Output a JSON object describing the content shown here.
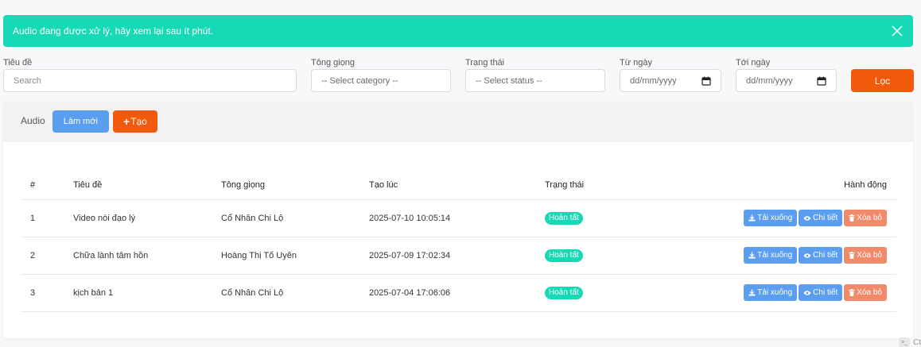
{
  "alert": {
    "message": "Audio đang được xử lý, hãy xem lại sau ít phút."
  },
  "filters": {
    "title_label": "Tiêu đề",
    "title_placeholder": "Search",
    "voice_label": "Tông giọng",
    "voice_value": "-- Select category --",
    "status_label": "Trạng thái",
    "status_value": "-- Select status --",
    "from_label": "Từ ngày",
    "from_value": "dd/mm/yyyy",
    "to_label": "Tới ngày",
    "to_value": "dd/mm/yyyy",
    "filter_button": "Lọc"
  },
  "card": {
    "title": "Audio",
    "refresh_button": "Làm mới",
    "create_button": "Tạo"
  },
  "table": {
    "headers": {
      "hash": "#",
      "title": "Tiêu đề",
      "voice": "Tông giọng",
      "created": "Tạo lúc",
      "status": "Trạng thái",
      "actions": "Hành động"
    },
    "rows": [
      {
        "index": "1",
        "title": "Video nói đạo lý",
        "voice": "Cổ Nhân Chi Lộ",
        "created": "2025-07-10 10:05:14",
        "status": "Hoàn tất"
      },
      {
        "index": "2",
        "title": "Chữa lành tâm hồn",
        "voice": "Hoàng Thị Tố Uyên",
        "created": "2025-07-09 17:02:34",
        "status": "Hoàn tất"
      },
      {
        "index": "3",
        "title": "kịch bản 1",
        "voice": "Cổ Nhân Chi Lộ",
        "created": "2025-07-04 17:06:06",
        "status": "Hoàn tất"
      }
    ],
    "action_labels": {
      "download": "Tải xuống",
      "detail": "Chi tiết",
      "delete": "Xóa bỏ"
    }
  },
  "corner": {
    "text": "Ct"
  },
  "colors": {
    "accent_teal": "#17d9b5",
    "primary_orange": "#f25a0b",
    "primary_blue": "#5b9ef0",
    "danger_salmon": "#f08a6b"
  }
}
